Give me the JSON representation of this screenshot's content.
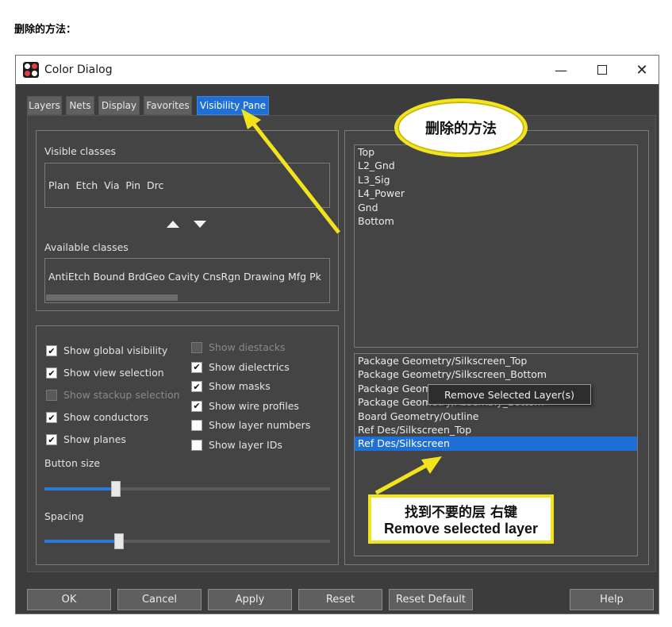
{
  "heading": "删除的方法：",
  "window": {
    "title": "Color Dialog",
    "minimize": "—",
    "close": "✕"
  },
  "tabs": [
    "Layers",
    "Nets",
    "Display",
    "Favorites",
    "Visibility Pane"
  ],
  "visible_classes": {
    "label": "Visible classes",
    "items": "Plan  Etch  Via  Pin  Drc"
  },
  "available_classes": {
    "label": "Available classes",
    "items": "AntiEtch  Bound  BrdGeo  Cavity  CnsRgn  Drawing  Mfg  Pk"
  },
  "options_left": [
    {
      "label": "Show global visibility",
      "checked": true,
      "enabled": true
    },
    {
      "label": "Show view selection",
      "checked": true,
      "enabled": true
    },
    {
      "label": "Show stackup selection",
      "checked": false,
      "enabled": false
    },
    {
      "label": "Show conductors",
      "checked": true,
      "enabled": true
    },
    {
      "label": "Show planes",
      "checked": true,
      "enabled": true
    }
  ],
  "options_right": [
    {
      "label": "Show diestacks",
      "checked": false,
      "enabled": false
    },
    {
      "label": "Show dielectrics",
      "checked": true,
      "enabled": true
    },
    {
      "label": "Show masks",
      "checked": true,
      "enabled": true
    },
    {
      "label": "Show wire profiles",
      "checked": true,
      "enabled": true
    },
    {
      "label": "Show layer numbers",
      "checked": false,
      "enabled": true
    },
    {
      "label": "Show layer IDs",
      "checked": false,
      "enabled": true
    }
  ],
  "button_size": {
    "label": "Button size",
    "value": 0.25
  },
  "spacing": {
    "label": "Spacing",
    "value": 0.26
  },
  "layers_list": [
    "Top",
    "L2_Gnd",
    "L3_Sig",
    "L4_Power",
    "Gnd",
    "Bottom"
  ],
  "subclass_list": [
    "Package Geometry/Silkscreen_Top",
    "Package Geometry/Silkscreen_Bottom",
    "Package Geometry/Assembly_Top",
    "Package Geometry/Assembly_Bottom",
    "Board Geometry/Outline",
    "Ref Des/Silkscreen_Top",
    "Ref Des/Silkscreen"
  ],
  "context_menu": {
    "item": "Remove Selected Layer(s)"
  },
  "callout_top": "删除的方法",
  "callout_bottom": {
    "line1": "找到不要的层 右键",
    "line2": "Remove selected layer"
  },
  "buttons": [
    "OK",
    "Cancel",
    "Apply",
    "Reset",
    "Reset Default",
    "Help"
  ],
  "colors": {
    "accent": "#1f70d6",
    "callout_border": "#f2e41c",
    "dialog_bg": "#444444"
  }
}
